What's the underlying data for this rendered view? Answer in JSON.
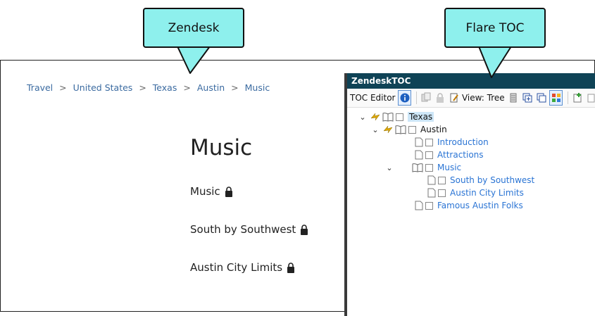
{
  "callouts": {
    "zendesk": "Zendesk",
    "flare": "Flare TOC"
  },
  "breadcrumb": [
    "Travel",
    "United States",
    "Texas",
    "Austin",
    "Music"
  ],
  "breadcrumb_sep": ">",
  "page": {
    "title": "Music",
    "articles": [
      "Music",
      "South by Southwest",
      "Austin City Limits"
    ]
  },
  "toc": {
    "window_title": "ZendeskTOC",
    "toolbar": {
      "editor_label": "TOC Editor",
      "view_label": "View: Tree"
    },
    "tree": {
      "texas": "Texas",
      "austin": "Austin",
      "introduction": "Introduction",
      "attractions": "Attractions",
      "music": "Music",
      "south_by_southwest": "South by Southwest",
      "austin_city_limits": "Austin City Limits",
      "famous_austin_folks": "Famous Austin Folks"
    }
  },
  "colors": {
    "callout_fill": "#8ef0ed",
    "titlebar": "#0f4356",
    "link": "#2a74d4",
    "breadcrumb": "#3a6aa0"
  }
}
